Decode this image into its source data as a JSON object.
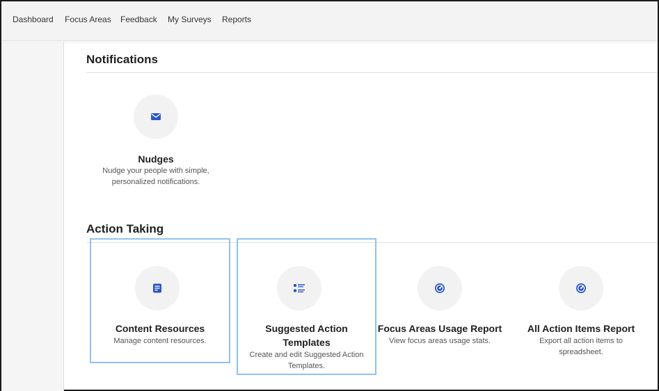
{
  "nav": {
    "items": [
      {
        "label": "Dashboard"
      },
      {
        "label": "Focus Areas"
      },
      {
        "label": "Feedback"
      },
      {
        "label": "My Surveys"
      },
      {
        "label": "Reports"
      }
    ]
  },
  "sections": {
    "notifications": {
      "title": "Notifications",
      "tiles": [
        {
          "title": "Nudges",
          "desc_line1": "Nudge your people with simple,",
          "desc_line2": "personalized notifications.",
          "icon": "envelope-icon"
        }
      ]
    },
    "action_taking": {
      "title": "Action Taking",
      "tiles": [
        {
          "title": "Content Resources",
          "desc_line1": "Manage content resources.",
          "icon": "document-icon",
          "selected": true
        },
        {
          "title_line1": "Suggested Action",
          "title_line2": "Templates",
          "desc_line1": "Create and edit Suggested Action",
          "desc_line2": "Templates.",
          "icon": "list-icon",
          "selected": true
        },
        {
          "title": "Focus Areas Usage Report",
          "desc_line1": "View focus areas usage stats.",
          "icon": "gauge-icon"
        },
        {
          "title": "All Action Items Report",
          "desc_line1": "Export all action items to",
          "desc_line2": "spreadsheet.",
          "icon": "gauge-icon"
        }
      ]
    }
  },
  "colors": {
    "icon_blue": "#2b55c7",
    "selection_outline": "#8fc1ef",
    "circle_bg": "#f2f2f2"
  }
}
